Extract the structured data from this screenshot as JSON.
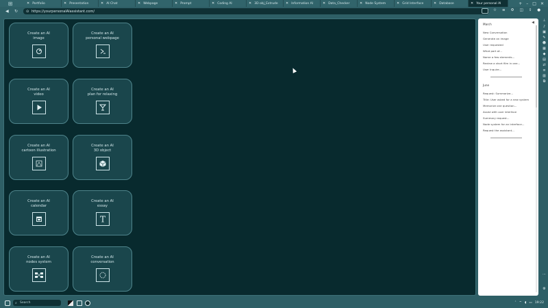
{
  "browser": {
    "tabs": [
      {
        "label": "Portfolio",
        "active": false
      },
      {
        "label": "Presentation",
        "active": false
      },
      {
        "label": "AI Chat",
        "active": false
      },
      {
        "label": "Webpage",
        "active": false
      },
      {
        "label": "Prompt",
        "active": false
      },
      {
        "label": "Coding AI",
        "active": false
      },
      {
        "label": "3D obj_Extrude",
        "active": false
      },
      {
        "label": "Information AI",
        "active": false
      },
      {
        "label": "Data_Checker",
        "active": false
      },
      {
        "label": "Node System",
        "active": false
      },
      {
        "label": "Grid Interface",
        "active": false
      },
      {
        "label": "Database",
        "active": false
      },
      {
        "label": "Your personal AI",
        "active": true
      }
    ],
    "url": "https://yourpersonalAIassistant.com/"
  },
  "cards": [
    {
      "line1": "Create an AI",
      "line2": "image",
      "icon": "image-icon"
    },
    {
      "line1": "Create an AI",
      "line2": "personal webpage",
      "icon": "terminal-icon"
    },
    {
      "line1": "Create an AI",
      "line2": "video",
      "icon": "play-icon"
    },
    {
      "line1": "Create an AI",
      "line2": "plan for relaxing",
      "icon": "cocktail-icon"
    },
    {
      "line1": "Create an AI",
      "line2": "cartoon illustration",
      "icon": "illustration-icon"
    },
    {
      "line1": "Create an AI",
      "line2": "3D object",
      "icon": "cube-icon"
    },
    {
      "line1": "Create an AI",
      "line2": "calendar",
      "icon": "calendar-icon"
    },
    {
      "line1": "Create an AI",
      "line2": "essay",
      "icon": "text-icon"
    },
    {
      "line1": "Create an AI",
      "line2": "nodes system",
      "icon": "nodes-icon"
    },
    {
      "line1": "Create an AI",
      "line2": "conversation",
      "icon": "conversation-icon"
    }
  ],
  "history": {
    "sections": [
      {
        "heading": "March",
        "items": [
          "New Conversation",
          "Generate an image",
          "User requested",
          "What part of...",
          "Name a few elements...",
          "Review a short film in one...",
          "User Inquire..."
        ]
      },
      {
        "heading": "June",
        "items": [
          "Request: Summarize...",
          "Title: User asked for a new system",
          "Memorize one question...",
          "Assist with user interface",
          "Summary request...",
          "Node system for an interface...",
          "Request the assistant..."
        ]
      }
    ]
  },
  "taskbar": {
    "search_placeholder": "Search",
    "time": "19:22"
  },
  "colors": {
    "chrome": "#2e5f66",
    "main_bg": "#082a2e",
    "card_bg": "#1a464c"
  }
}
